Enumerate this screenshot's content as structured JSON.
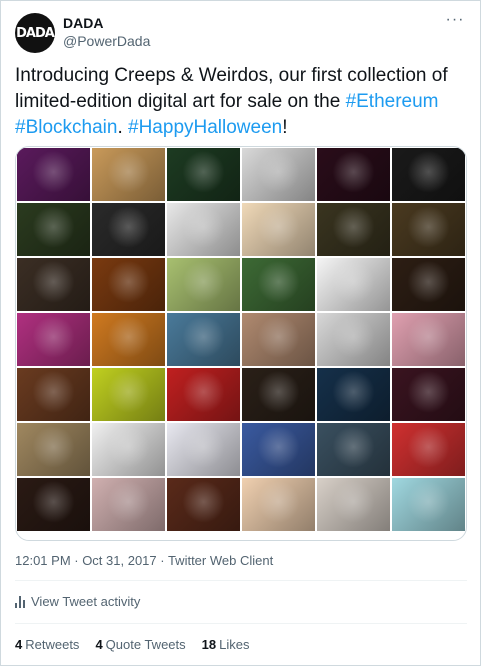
{
  "author": {
    "display_name": "DADA",
    "handle": "@PowerDada",
    "avatar_text": "DADA"
  },
  "tweet": {
    "text_plain_1": "Introducing Creeps & Weirdos, our first collection of limited-edition digital art for sale on the ",
    "hashtag_1": "#Ethereum",
    "text_plain_2": " ",
    "hashtag_2": "#Blockchain",
    "text_plain_3": ". ",
    "hashtag_3": "#HappyHalloween",
    "text_plain_4": "!"
  },
  "media": {
    "tiles": [
      [
        "#5a1a5c",
        "#c99a5a",
        "#1d3b22",
        "#d9d9d9",
        "#2a0d1a",
        "#1a1a1a"
      ],
      [
        "#2b3b1f",
        "#2a2a2a",
        "#e8e8e8",
        "#f0d9b8",
        "#3a3520",
        "#4a3a20"
      ],
      [
        "#3b2e24",
        "#7a3a10",
        "#a8c070",
        "#3d6a35",
        "#f5f5f5",
        "#2d1e14"
      ],
      [
        "#b03080",
        "#d07a20",
        "#4a7a9a",
        "#b08a70",
        "#d8d8d8",
        "#e0a0b0"
      ],
      [
        "#6a3b20",
        "#c0d020",
        "#c02020",
        "#2a2018",
        "#15304a",
        "#3a1420"
      ],
      [
        "#a08860",
        "#f0f0f0",
        "#e8e8f0",
        "#3a5aa0",
        "#3a5060",
        "#d03030"
      ],
      [
        "#2a1a14",
        "#d0b0b0",
        "#5a2a1a",
        "#f0d0b0",
        "#d8d0c8",
        "#a0d8e0"
      ]
    ]
  },
  "meta": {
    "timestamp": "12:01 PM · Oct 31, 2017 · Twitter Web Client"
  },
  "activity": {
    "label": "View Tweet activity"
  },
  "stats": {
    "retweets_count": "4",
    "retweets_label": "Retweets",
    "quotes_count": "4",
    "quotes_label": "Quote Tweets",
    "likes_count": "18",
    "likes_label": "Likes"
  },
  "colors": {
    "link": "#1d9bf0",
    "secondary_text": "#536471",
    "primary_text": "#0f1419"
  }
}
